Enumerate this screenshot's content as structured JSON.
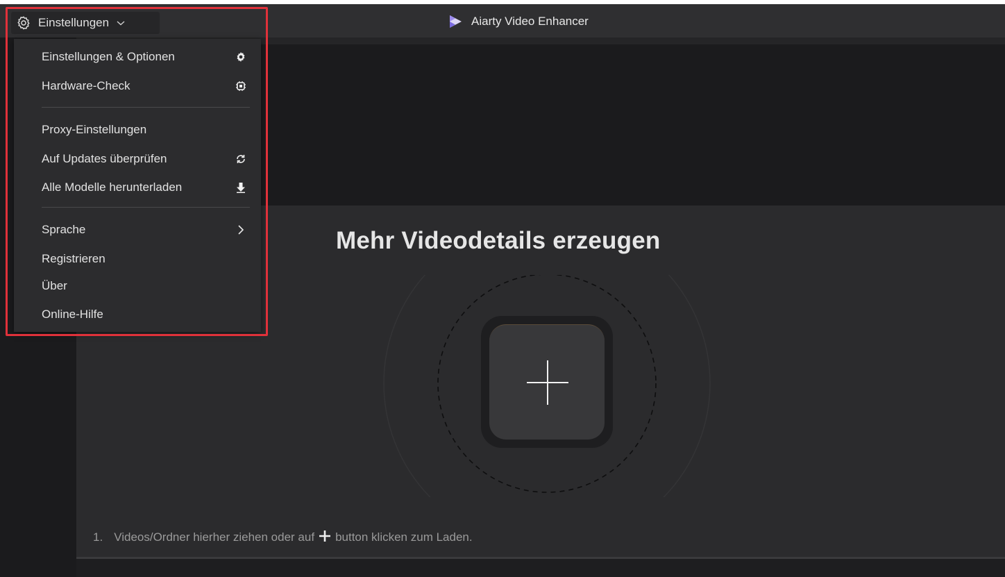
{
  "titlebar": {
    "app_title": "Aiarty Video Enhancer",
    "settings_label": "Einstellungen",
    "settings_icon": "gear-icon",
    "dropdown_icon": "chevron-down-icon"
  },
  "menu": {
    "items": [
      {
        "label": "Einstellungen & Optionen",
        "icon": "gear-icon"
      },
      {
        "label": "Hardware-Check",
        "icon": "chip-icon"
      },
      {
        "label": "Proxy-Einstellungen",
        "icon": ""
      },
      {
        "label": "Auf Updates überprüfen",
        "icon": "refresh-icon"
      },
      {
        "label": "Alle Modelle herunterladen",
        "icon": "download-icon"
      },
      {
        "label": "Sprache",
        "icon": "chevron-right-icon"
      },
      {
        "label": "Registrieren",
        "icon": ""
      },
      {
        "label": "Über",
        "icon": ""
      },
      {
        "label": "Online-Hilfe",
        "icon": ""
      }
    ],
    "highlight_color": "#e0313a"
  },
  "main": {
    "title": "Mehr Videodetails erzeugen",
    "add_icon": "plus-icon",
    "hint_number": "1.",
    "hint_before": "Videos/Ordner hierher ziehen oder auf",
    "hint_after": "button klicken zum Laden."
  },
  "colors": {
    "background": "#1c1c1e",
    "titlebar": "#2f2f31",
    "menu": "#2c2c2e",
    "main_area": "#2b2b2d",
    "accent_highlight": "#e0313a"
  }
}
